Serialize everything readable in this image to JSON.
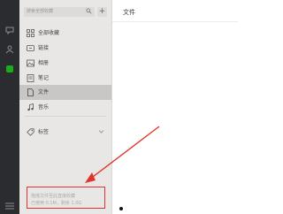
{
  "sidebar": {
    "search_placeholder": "搜索全部收藏",
    "add_label": "+",
    "items": [
      {
        "label": "全部收藏",
        "icon": "grid-icon"
      },
      {
        "label": "链接",
        "icon": "link-icon"
      },
      {
        "label": "相册",
        "icon": "image-icon"
      },
      {
        "label": "笔记",
        "icon": "note-icon"
      },
      {
        "label": "文件",
        "icon": "file-icon"
      },
      {
        "label": "音乐",
        "icon": "music-icon"
      }
    ],
    "tags_label": "标签",
    "hint_line1": "拖拽文件至此直接收藏",
    "hint_line2": "已使用 0.1M，剩余 1.0G"
  },
  "main": {
    "title": "文件"
  },
  "colors": {
    "rail": "#2b2c2f",
    "sidebar": "#e8e7e6",
    "active_item": "#c8c7c6",
    "highlight": "#e2332a",
    "status_green": "#1aad19"
  }
}
